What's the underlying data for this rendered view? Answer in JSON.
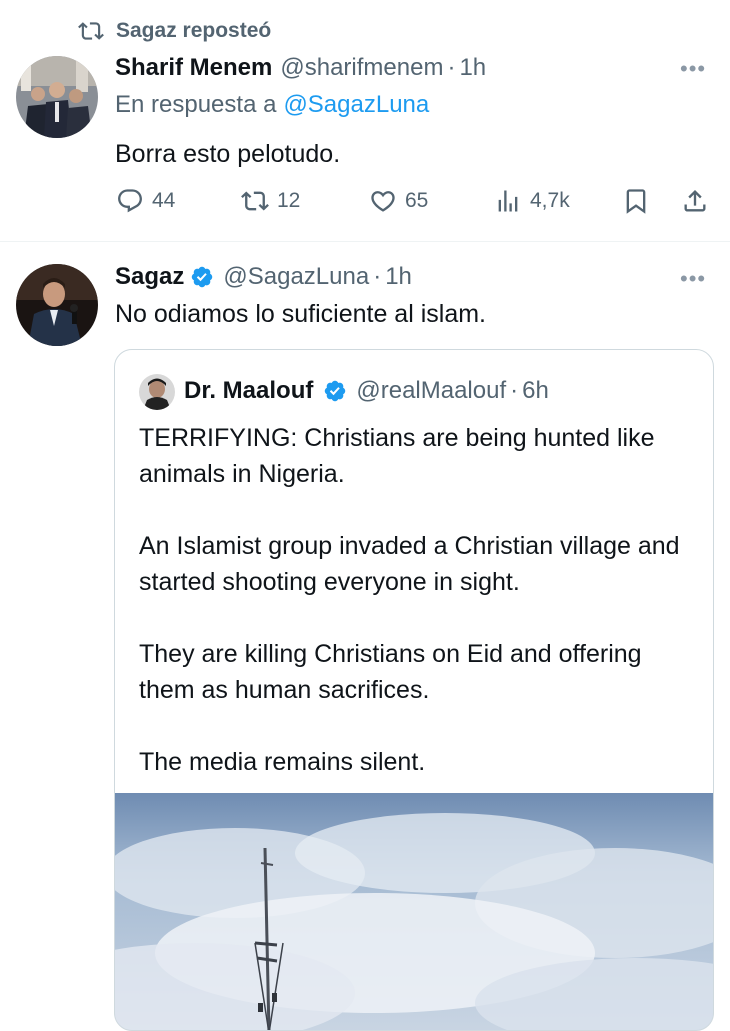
{
  "repost": {
    "label": "Sagaz reposteó",
    "icon": "repost-icon"
  },
  "reply_tweet": {
    "author_name": "Sharif Menem",
    "author_handle": "@sharifmenem",
    "separator": "·",
    "time": "1h",
    "reply_prefix": "En respuesta a",
    "reply_handle": "@SagazLuna",
    "text": "Borra esto pelotudo.",
    "stats": {
      "replies": "44",
      "reposts": "12",
      "likes": "65",
      "views": "4,7k"
    }
  },
  "main_tweet": {
    "author_name": "Sagaz",
    "author_handle": "@SagazLuna",
    "separator": "·",
    "time": "1h",
    "text": "No odiamos lo suficiente al islam."
  },
  "quoted_tweet": {
    "author_name": "Dr. Maalouf",
    "author_handle": "@realMaalouf",
    "separator": "·",
    "time": "6h",
    "text": "TERRIFYING: Christians are being hunted like animals in Nigeria.\n\nAn Islamist group invaded a Christian village and started shooting everyone in sight.\n\nThey are killing Christians on Eid and offering them as human sacrifices.\n\nThe media remains silent."
  },
  "more_label": "•••",
  "colors": {
    "accent": "#1d9bf0",
    "secondary_text": "#536471",
    "primary_text": "#0f1419",
    "border": "#cfd9de"
  }
}
